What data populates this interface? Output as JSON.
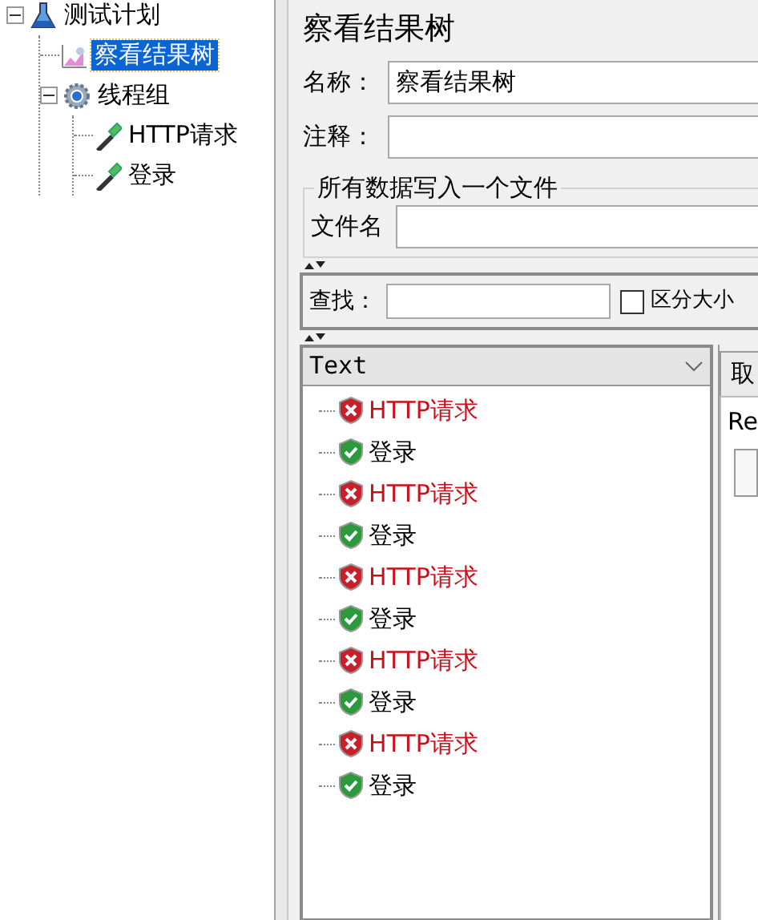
{
  "tree": [
    {
      "label": "测试计划",
      "kind": "plan",
      "expanded": true,
      "selected": false,
      "children": [
        {
          "label": "察看结果树",
          "kind": "listener",
          "selected": true
        },
        {
          "label": "线程组",
          "kind": "thread-group",
          "expanded": true,
          "selected": false,
          "children": [
            {
              "label": "HTTP请求",
              "kind": "sampler",
              "selected": false
            },
            {
              "label": "登录",
              "kind": "sampler",
              "selected": false
            }
          ]
        }
      ]
    }
  ],
  "title": "察看结果树",
  "name_field": {
    "label": "名称：",
    "value": "察看结果树"
  },
  "comment_field": {
    "label": "注释："
  },
  "file_group": {
    "legend": "所有数据写入一个文件",
    "label": "文件名"
  },
  "search": {
    "label": "查找：",
    "case_checkbox": {
      "label": "区分大小",
      "checked": false
    }
  },
  "renderer": {
    "value": "Text"
  },
  "results": [
    {
      "label": "HTTP请求",
      "success": false
    },
    {
      "label": "登录",
      "success": true
    },
    {
      "label": "HTTP请求",
      "success": false
    },
    {
      "label": "登录",
      "success": true
    },
    {
      "label": "HTTP请求",
      "success": false
    },
    {
      "label": "登录",
      "success": true
    },
    {
      "label": "HTTP请求",
      "success": false
    },
    {
      "label": "登录",
      "success": true
    },
    {
      "label": "HTTP请求",
      "success": false
    },
    {
      "label": "登录",
      "success": true
    }
  ],
  "detail_tab": {
    "label": "取"
  },
  "detail_label": "Re"
}
